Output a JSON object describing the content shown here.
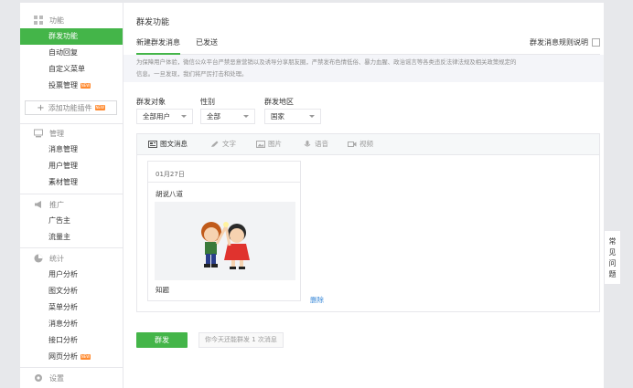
{
  "sidebar": {
    "sections": [
      {
        "title": "功能",
        "icon": "grid-icon",
        "items": [
          {
            "label": "群发功能",
            "active": true,
            "new": false
          },
          {
            "label": "自动回复",
            "active": false,
            "new": false
          },
          {
            "label": "自定义菜单",
            "active": false,
            "new": false
          },
          {
            "label": "投票管理",
            "active": false,
            "new": true
          }
        ]
      },
      {
        "title": "管理",
        "icon": "monitor-icon",
        "items": [
          {
            "label": "消息管理"
          },
          {
            "label": "用户管理"
          },
          {
            "label": "素材管理"
          }
        ]
      },
      {
        "title": "推广",
        "icon": "megaphone-icon",
        "items": [
          {
            "label": "广告主"
          },
          {
            "label": "流量主"
          }
        ]
      },
      {
        "title": "统计",
        "icon": "pie-chart-icon",
        "items": [
          {
            "label": "用户分析"
          },
          {
            "label": "图文分析"
          },
          {
            "label": "菜单分析"
          },
          {
            "label": "消息分析"
          },
          {
            "label": "接口分析"
          },
          {
            "label": "网页分析",
            "new": true
          }
        ]
      },
      {
        "title": "设置",
        "icon": "gear-icon",
        "items": []
      }
    ],
    "add_plugin_label": "添加功能插件",
    "new_badge_text": "NEW"
  },
  "main": {
    "title": "群发功能",
    "tabs": [
      {
        "label": "新建群发消息",
        "active": true
      },
      {
        "label": "已发送",
        "active": false
      }
    ],
    "rules_link": "群发消息规则说明",
    "notice_line1": "为保障用户体验，微信公众平台严禁恶意营销以及诱导分享朋友圈，严禁发布色情低俗、暴力血腥、政治谣言等各类违反法律法规及相关政策规定的",
    "notice_line2": "信息。一旦发现，我们将严厉打击和处理。",
    "filters": {
      "target_label": "群发对象",
      "target_value": "全部用户",
      "gender_label": "性别",
      "gender_value": "全部",
      "region_label": "群发地区",
      "region_value": "国家"
    },
    "editor_tabs": [
      {
        "label": "图文消息",
        "icon": "article-icon",
        "active": true
      },
      {
        "label": "文字",
        "icon": "pen-icon",
        "active": false
      },
      {
        "label": "图片",
        "icon": "image-icon",
        "active": false
      },
      {
        "label": "语音",
        "icon": "microphone-icon",
        "active": false
      },
      {
        "label": "视频",
        "icon": "video-icon",
        "active": false
      }
    ],
    "card": {
      "date": "01月27日",
      "title": "胡说八道",
      "footer": "知题"
    },
    "delete_label": "删除",
    "send_button": "群发",
    "quota_text": "你今天还能群发 1 次消息"
  },
  "faq": {
    "chars": [
      "常",
      "见",
      "问",
      "题"
    ]
  },
  "colors": {
    "accent": "#44b549",
    "link": "#3a89d8",
    "badge": "#ff8b31"
  }
}
